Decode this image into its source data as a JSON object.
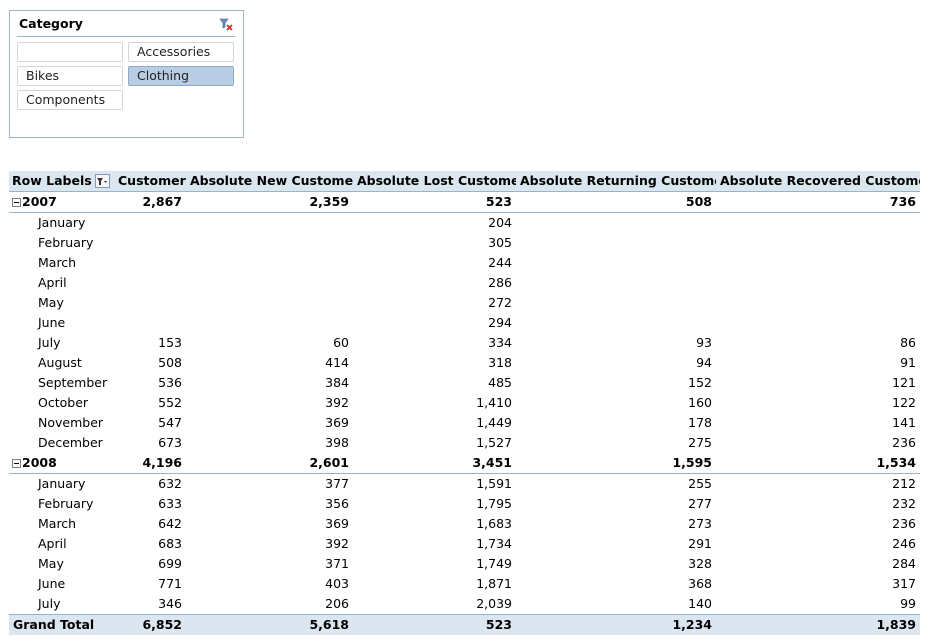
{
  "slicer": {
    "title": "Category",
    "items": [
      {
        "label": "",
        "selected": false
      },
      {
        "label": "Accessories",
        "selected": false
      },
      {
        "label": "Bikes",
        "selected": false
      },
      {
        "label": "Clothing",
        "selected": true
      },
      {
        "label": "Components",
        "selected": false
      }
    ],
    "clear_filter_icon": "clear-filter-icon"
  },
  "pivot": {
    "headers": {
      "row_labels": "Row Labels",
      "customers": "Customers",
      "new": "Absolute New Customers",
      "lost": "Absolute Lost Customers",
      "returning": "Absolute Returning Customers",
      "recovered": "Absolute Recovered Customers"
    },
    "years": [
      {
        "label": "2007",
        "values": [
          "2,867",
          "2,359",
          "523",
          "508",
          "736"
        ],
        "months": [
          {
            "label": "January",
            "values": [
              "",
              "",
              "204",
              "",
              ""
            ]
          },
          {
            "label": "February",
            "values": [
              "",
              "",
              "305",
              "",
              ""
            ]
          },
          {
            "label": "March",
            "values": [
              "",
              "",
              "244",
              "",
              ""
            ]
          },
          {
            "label": "April",
            "values": [
              "",
              "",
              "286",
              "",
              ""
            ]
          },
          {
            "label": "May",
            "values": [
              "",
              "",
              "272",
              "",
              ""
            ]
          },
          {
            "label": "June",
            "values": [
              "",
              "",
              "294",
              "",
              ""
            ]
          },
          {
            "label": "July",
            "values": [
              "153",
              "60",
              "334",
              "93",
              "86"
            ]
          },
          {
            "label": "August",
            "values": [
              "508",
              "414",
              "318",
              "94",
              "91"
            ]
          },
          {
            "label": "September",
            "values": [
              "536",
              "384",
              "485",
              "152",
              "121"
            ]
          },
          {
            "label": "October",
            "values": [
              "552",
              "392",
              "1,410",
              "160",
              "122"
            ]
          },
          {
            "label": "November",
            "values": [
              "547",
              "369",
              "1,449",
              "178",
              "141"
            ]
          },
          {
            "label": "December",
            "values": [
              "673",
              "398",
              "1,527",
              "275",
              "236"
            ]
          }
        ]
      },
      {
        "label": "2008",
        "values": [
          "4,196",
          "2,601",
          "3,451",
          "1,595",
          "1,534"
        ],
        "months": [
          {
            "label": "January",
            "values": [
              "632",
              "377",
              "1,591",
              "255",
              "212"
            ]
          },
          {
            "label": "February",
            "values": [
              "633",
              "356",
              "1,795",
              "277",
              "232"
            ]
          },
          {
            "label": "March",
            "values": [
              "642",
              "369",
              "1,683",
              "273",
              "236"
            ]
          },
          {
            "label": "April",
            "values": [
              "683",
              "392",
              "1,734",
              "291",
              "246"
            ]
          },
          {
            "label": "May",
            "values": [
              "699",
              "371",
              "1,749",
              "328",
              "284"
            ]
          },
          {
            "label": "June",
            "values": [
              "771",
              "403",
              "1,871",
              "368",
              "317"
            ]
          },
          {
            "label": "July",
            "values": [
              "346",
              "206",
              "2,039",
              "140",
              "99"
            ]
          }
        ]
      }
    ],
    "grand_total": {
      "label": "Grand Total",
      "values": [
        "6,852",
        "5,618",
        "523",
        "1,234",
        "1,839"
      ]
    }
  },
  "colors": {
    "header_fill": "#dce6f1",
    "selected_item": "#b8cce4",
    "border": "#95b3d7"
  }
}
